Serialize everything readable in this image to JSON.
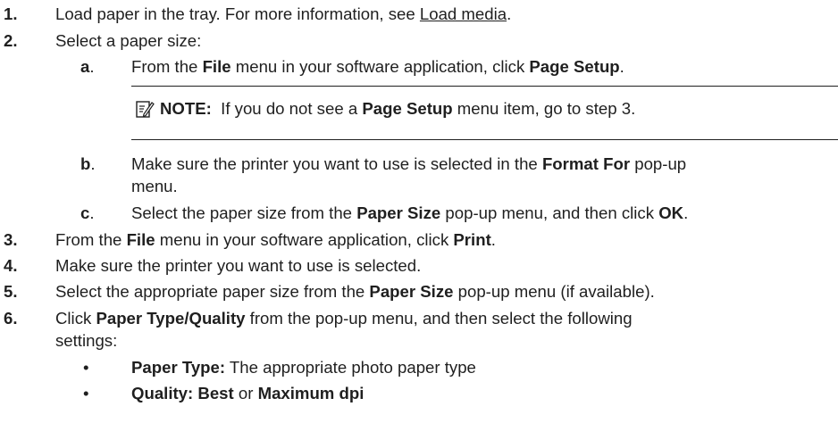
{
  "steps": {
    "s1": {
      "num": "1.",
      "pre": "Load paper in the tray. For more information, see ",
      "link": "Load media",
      "post": "."
    },
    "s2": {
      "num": "2.",
      "text": "Select a paper size:"
    },
    "a": {
      "label": "a",
      "dot": ".",
      "pre": "From the ",
      "b1": "File",
      "mid": " menu in your software application, click ",
      "b2": "Page Setup",
      "post": "."
    },
    "note": {
      "label": "NOTE:",
      "pre": "  If you do not see a ",
      "b1": "Page Setup",
      "post": " menu item, go to step 3."
    },
    "b": {
      "label": "b",
      "dot": ".",
      "pre": "Make sure the printer you want to use is selected in the ",
      "b1": "Format For",
      "post": " pop-up",
      "line2": "menu."
    },
    "c": {
      "label": "c",
      "dot": ".",
      "pre": "Select the paper size from the ",
      "b1": "Paper Size",
      "mid": " pop-up menu, and then click ",
      "b2": "OK",
      "post": "."
    },
    "s3": {
      "num": "3.",
      "pre": "From the ",
      "b1": "File",
      "mid": " menu in your software application, click ",
      "b2": "Print",
      "post": "."
    },
    "s4": {
      "num": "4.",
      "text": "Make sure the printer you want to use is selected."
    },
    "s5": {
      "num": "5.",
      "pre": "Select the appropriate paper size from the ",
      "b1": "Paper Size",
      "post": " pop-up menu (if available)."
    },
    "s6": {
      "num": "6.",
      "pre": "Click ",
      "b1": "Paper Type/Quality",
      "post": " from the pop-up menu, and then select the following",
      "line2": "settings:"
    },
    "bullets": [
      {
        "mark": "•",
        "b1": "Paper Type:",
        "post": " The appropriate photo paper type"
      },
      {
        "mark": "•",
        "b1": "Quality:",
        "mid": " ",
        "b2": "Best",
        "mid2": " or ",
        "b3": "Maximum dpi"
      }
    ]
  }
}
